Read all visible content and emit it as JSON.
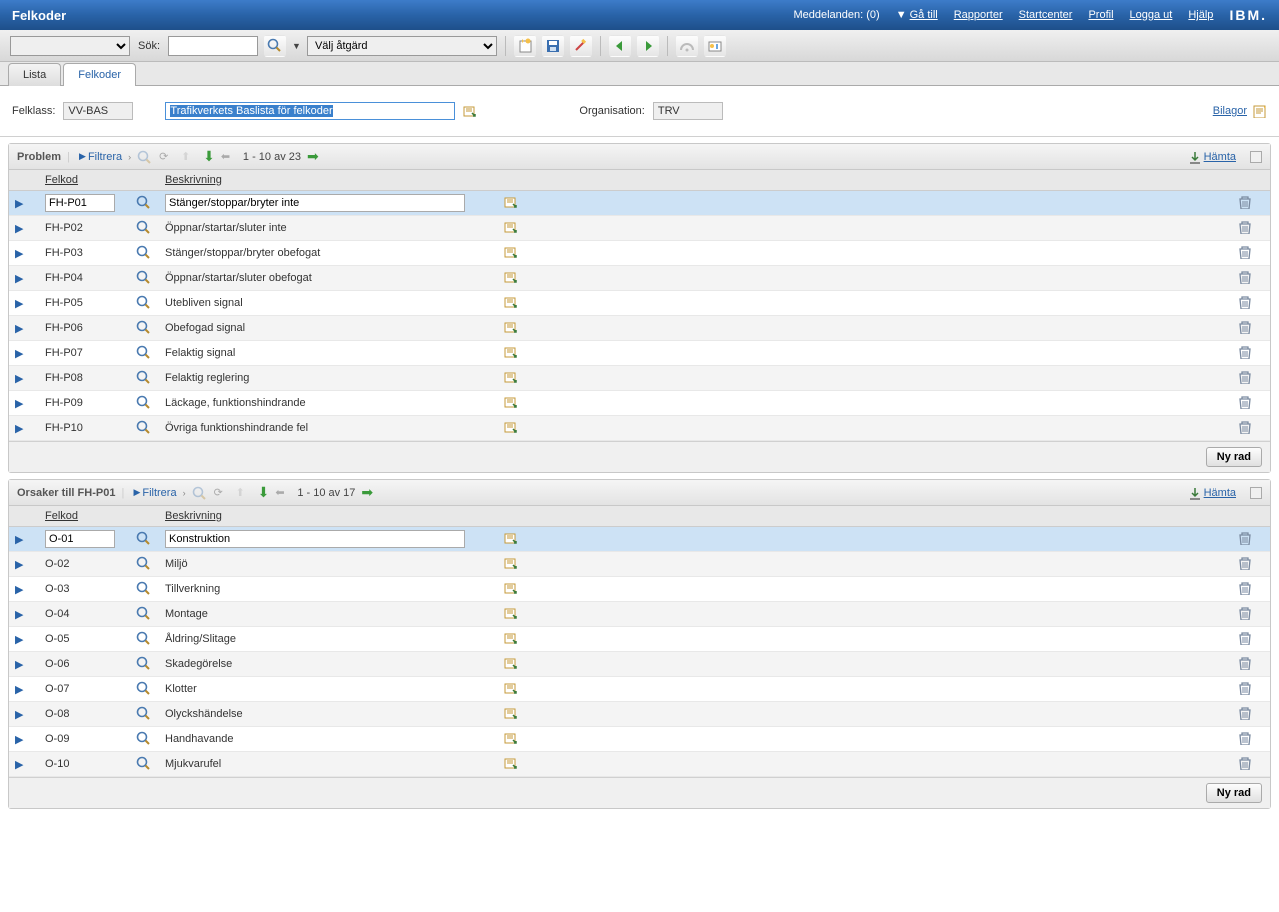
{
  "banner": {
    "title": "Felkoder",
    "messages": "Meddelanden: (0)",
    "goto": "Gå till",
    "links": [
      "Rapporter",
      "Startcenter",
      "Profil",
      "Logga ut",
      "Hjälp"
    ],
    "logo": "IBM."
  },
  "toolbar": {
    "sok_label": "Sök:",
    "action_placeholder": "Välj åtgärd"
  },
  "tabs": {
    "lista": "Lista",
    "felkoder": "Felkoder"
  },
  "form": {
    "felklass_label": "Felklass:",
    "felklass": "VV-BAS",
    "felklass_desc": "Trafikverkets Baslista för felkoder",
    "org_label": "Organisation:",
    "org": "TRV",
    "bilagor": "Bilagor"
  },
  "table1": {
    "title": "Problem",
    "filtrera": "Filtrera",
    "pager": "1 - 10 av 23",
    "hamta": "Hämta",
    "col_felkod": "Felkod",
    "col_besk": "Beskrivning",
    "nyrad": "Ny rad",
    "rows": [
      {
        "code": "FH-P01",
        "desc": "Stänger/stoppar/bryter inte",
        "selected": true
      },
      {
        "code": "FH-P02",
        "desc": "Öppnar/startar/sluter inte"
      },
      {
        "code": "FH-P03",
        "desc": "Stänger/stoppar/bryter obefogat"
      },
      {
        "code": "FH-P04",
        "desc": "Öppnar/startar/sluter obefogat"
      },
      {
        "code": "FH-P05",
        "desc": "Utebliven signal"
      },
      {
        "code": "FH-P06",
        "desc": "Obefogad signal"
      },
      {
        "code": "FH-P07",
        "desc": "Felaktig signal"
      },
      {
        "code": "FH-P08",
        "desc": "Felaktig reglering"
      },
      {
        "code": "FH-P09",
        "desc": "Läckage, funktionshindrande"
      },
      {
        "code": "FH-P10",
        "desc": "Övriga funktionshindrande fel"
      }
    ]
  },
  "table2": {
    "title": "Orsaker till FH-P01",
    "filtrera": "Filtrera",
    "pager": "1 - 10 av 17",
    "hamta": "Hämta",
    "col_felkod": "Felkod",
    "col_besk": "Beskrivning",
    "nyrad": "Ny rad",
    "rows": [
      {
        "code": "O-01",
        "desc": "Konstruktion",
        "selected": true
      },
      {
        "code": "O-02",
        "desc": "Miljö"
      },
      {
        "code": "O-03",
        "desc": "Tillverkning"
      },
      {
        "code": "O-04",
        "desc": "Montage"
      },
      {
        "code": "O-05",
        "desc": "Åldring/Slitage"
      },
      {
        "code": "O-06",
        "desc": "Skadegörelse"
      },
      {
        "code": "O-07",
        "desc": "Klotter"
      },
      {
        "code": "O-08",
        "desc": "Olyckshändelse"
      },
      {
        "code": "O-09",
        "desc": "Handhavande"
      },
      {
        "code": "O-10",
        "desc": "Mjukvarufel"
      }
    ]
  }
}
